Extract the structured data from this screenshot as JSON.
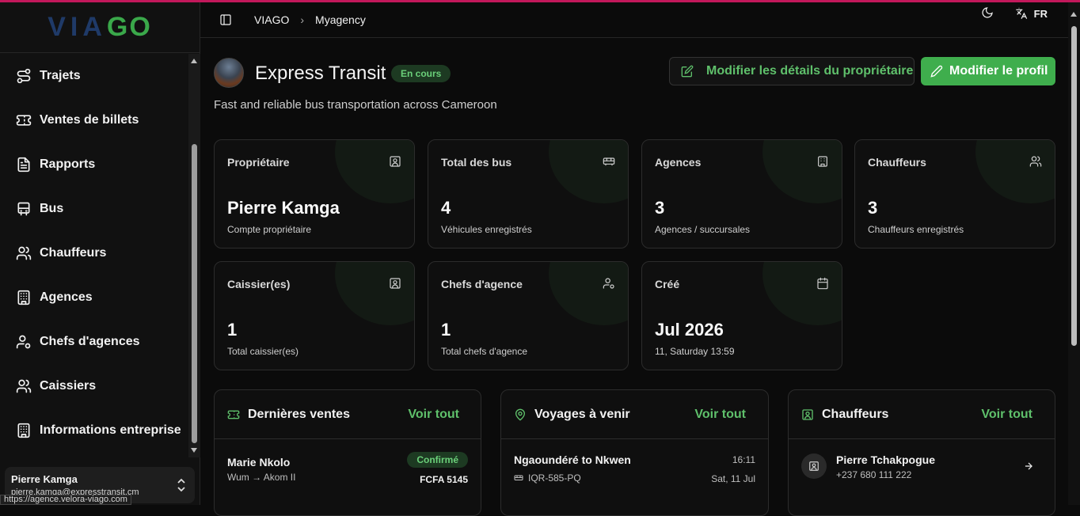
{
  "sidebar": {
    "logo_via": "VIA",
    "logo_go": "GO",
    "items": [
      {
        "label": "Trajets",
        "icon": "route-icon"
      },
      {
        "label": "Ventes de billets",
        "icon": "ticket-icon"
      },
      {
        "label": "Rapports",
        "icon": "file-icon"
      },
      {
        "label": "Bus",
        "icon": "bus-icon"
      },
      {
        "label": "Chauffeurs",
        "icon": "users-icon"
      },
      {
        "label": "Agences",
        "icon": "building-icon"
      },
      {
        "label": "Chefs d'agences",
        "icon": "user-cog-icon"
      },
      {
        "label": "Caissiers",
        "icon": "users-icon"
      },
      {
        "label": "Informations entreprise",
        "icon": "building-icon"
      }
    ],
    "user": {
      "name": "Pierre Kamga",
      "email": "pierre.kamga@expresstransit.cm"
    }
  },
  "status_url": "https://agence.velora-viago.com",
  "topbar": {
    "breadcrumb": [
      "VIAGO",
      "Myagency"
    ],
    "language": "FR"
  },
  "header": {
    "company": "Express Transit",
    "status": "En cours",
    "tagline": "Fast and reliable bus transportation across Cameroon",
    "btn_owner": "Modifier les détails du propriétaire",
    "btn_profile": "Modifier le profil"
  },
  "stats": [
    {
      "label": "Propriétaire",
      "value": "Pierre Kamga",
      "sub": "Compte propriétaire",
      "icon": "id-card-icon"
    },
    {
      "label": "Total des bus",
      "value": "4",
      "sub": "Véhicules enregistrés",
      "icon": "bus-icon"
    },
    {
      "label": "Agences",
      "value": "3",
      "sub": "Agences / succursales",
      "icon": "building-icon"
    },
    {
      "label": "Chauffeurs",
      "value": "3",
      "sub": "Chauffeurs enregistrés",
      "icon": "users-icon"
    },
    {
      "label": "Caissier(es)",
      "value": "1",
      "sub": "Total caissier(es)",
      "icon": "id-card-icon"
    },
    {
      "label": "Chefs d'agence",
      "value": "1",
      "sub": "Total chefs d'agence",
      "icon": "user-cog-icon"
    },
    {
      "label": "Créé",
      "value": "Jul 2026",
      "sub": "11, Saturday 13:59",
      "icon": "calendar-icon"
    }
  ],
  "panels": {
    "sales": {
      "title": "Dernières ventes",
      "view_all": "Voir tout",
      "row": {
        "name": "Marie Nkolo",
        "route": "Wum → Akom II",
        "status": "Confirmé",
        "amount": "FCFA 5145"
      }
    },
    "trips": {
      "title": "Voyages à venir",
      "view_all": "Voir tout",
      "row": {
        "route": "Ngaoundéré to Nkwen",
        "time": "16:11",
        "plate": "IQR-585-PQ",
        "date": "Sat, 11 Jul"
      }
    },
    "drivers": {
      "title": "Chauffeurs",
      "view_all": "Voir tout",
      "row": {
        "name": "Pierre Tchakpogue",
        "phone": "+237 680 111 222"
      }
    }
  }
}
